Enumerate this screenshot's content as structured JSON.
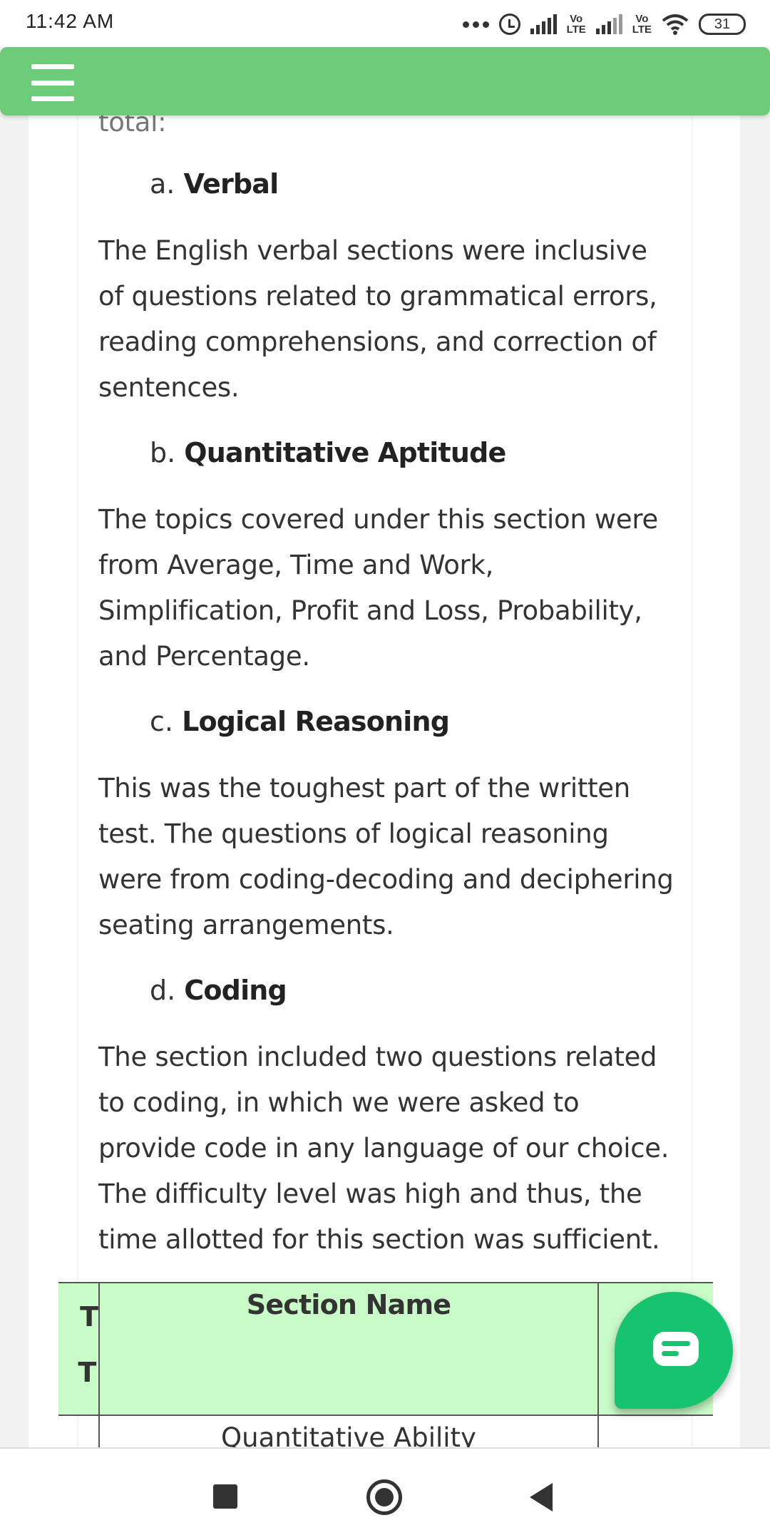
{
  "status_bar": {
    "time": "11:42 AM",
    "volte_1": "Vo\nLTE",
    "volte_2": "Vo\nLTE",
    "battery": "31"
  },
  "app_bar": {
    "menu_icon": "hamburger-menu-icon",
    "color": "#6ccb78"
  },
  "article": {
    "cut_text": "total:",
    "sections": [
      {
        "marker": "a.",
        "title": "Verbal",
        "body": "The English verbal sections were inclusive of questions related to grammatical errors, reading comprehensions, and correction of sentences."
      },
      {
        "marker": "b.",
        "title": "Quantitative Aptitude",
        "body": "The topics covered under this section were from Average, Time and Work, Simplification, Profit and Loss, Probability, and Percentage."
      },
      {
        "marker": "c.",
        "title": "Logical Reasoning",
        "body": "This was the toughest part of the written test. The questions of logical reasoning were from coding-decoding and deciphering seating arrangements."
      },
      {
        "marker": "d.",
        "title": "Coding",
        "body": "The section included two questions related to coding, in which we were asked to provide code in any language of our choice. The difficulty level was high and thus, the time allotted for this section was sufficient."
      }
    ]
  },
  "table": {
    "left_header_fragment_1": "T",
    "left_header_fragment_2": "(T",
    "section_header": "Section Name",
    "first_row": "Quantitative Ability",
    "header_bg": "#c9fbc8"
  },
  "chat_fab": {
    "icon": "chat-bubble-icon",
    "color": "#16c470"
  },
  "nav_bar": {
    "recent_icon": "recent-apps-icon",
    "home_icon": "home-icon",
    "back_icon": "back-icon"
  }
}
